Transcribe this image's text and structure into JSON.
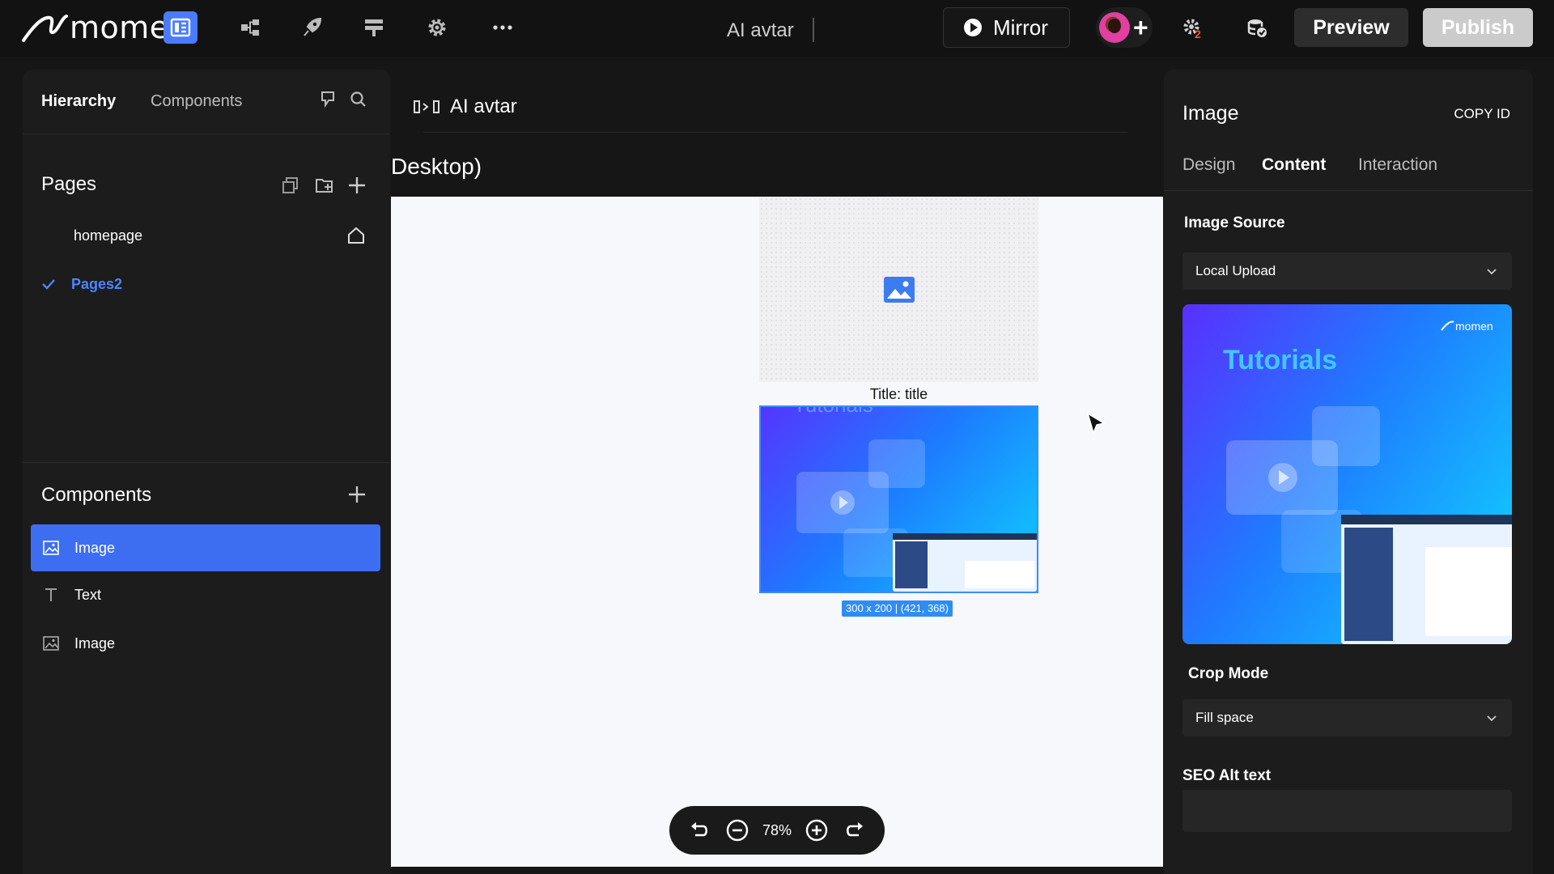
{
  "app": {
    "logo_text": "momen",
    "doc_title": "AI avtar",
    "mirror_label": "Mirror",
    "preview_label": "Preview",
    "publish_label": "Publish",
    "notification_count": "2"
  },
  "hierarchy": {
    "tabs": [
      "Hierarchy",
      "Components"
    ],
    "pages_title": "Pages",
    "pages": [
      {
        "label": "homepage",
        "home": true,
        "selected": false
      },
      {
        "label": "Pages2",
        "home": false,
        "selected": true
      }
    ],
    "components_title": "Components",
    "components": [
      {
        "label": "Image",
        "icon": "image-icon",
        "selected": true
      },
      {
        "label": "Text",
        "icon": "text-icon",
        "selected": false
      },
      {
        "label": "Image",
        "icon": "image-icon",
        "selected": false
      }
    ]
  },
  "canvas": {
    "breadcrumb": "AI avtar",
    "frame_label": "Desktop)",
    "image_title": "Title: title",
    "size_tag": "300 x 200 | (421, 368)",
    "zoom": "78%"
  },
  "inspector": {
    "title": "Image",
    "copy_id": "COPY ID",
    "tabs": [
      "Design",
      "Content",
      "Interaction"
    ],
    "active_tab": "Content",
    "image_source_label": "Image Source",
    "image_source_value": "Local Upload",
    "preview_heading": "Tutorials",
    "preview_brand": "momen",
    "crop_mode_label": "Crop Mode",
    "crop_mode_value": "Fill space",
    "seo_label": "SEO Alt text",
    "seo_value": ""
  },
  "colors": {
    "accent": "#3d6ef2",
    "selection": "#3a8cff",
    "panel": "#1c1c1c",
    "background": "#161616"
  }
}
